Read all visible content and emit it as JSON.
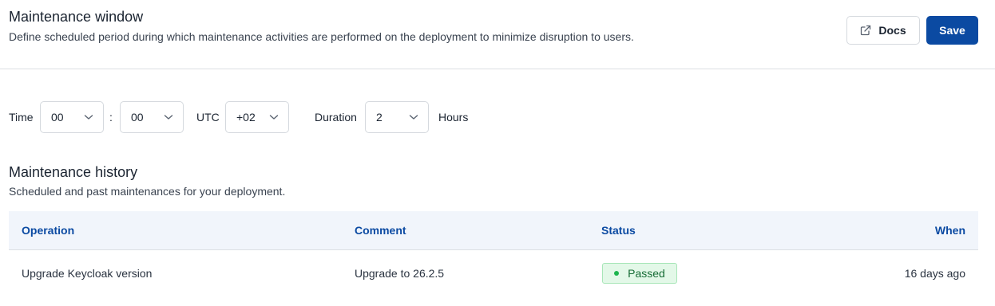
{
  "header": {
    "title": "Maintenance window",
    "subtitle": "Define scheduled period during which maintenance activities are performed on the deployment to minimize disruption to users.",
    "docs_label": "Docs",
    "save_label": "Save"
  },
  "schedule": {
    "time_label": "Time",
    "hour_value": "00",
    "separator": ":",
    "minute_value": "00",
    "utc_label": "UTC",
    "utc_offset_value": "+02",
    "duration_label": "Duration",
    "duration_value": "2",
    "hours_label": "Hours"
  },
  "history": {
    "title": "Maintenance history",
    "subtitle": "Scheduled and past maintenances for your deployment.",
    "columns": [
      "Operation",
      "Comment",
      "Status",
      "When"
    ],
    "rows": [
      {
        "operation": "Upgrade Keycloak version",
        "comment": "Upgrade to 26.2.5",
        "status": "Passed",
        "when": "16 days ago"
      }
    ]
  },
  "colors": {
    "accent": "#0b4aa2",
    "status_passed": "#1cb54d"
  }
}
